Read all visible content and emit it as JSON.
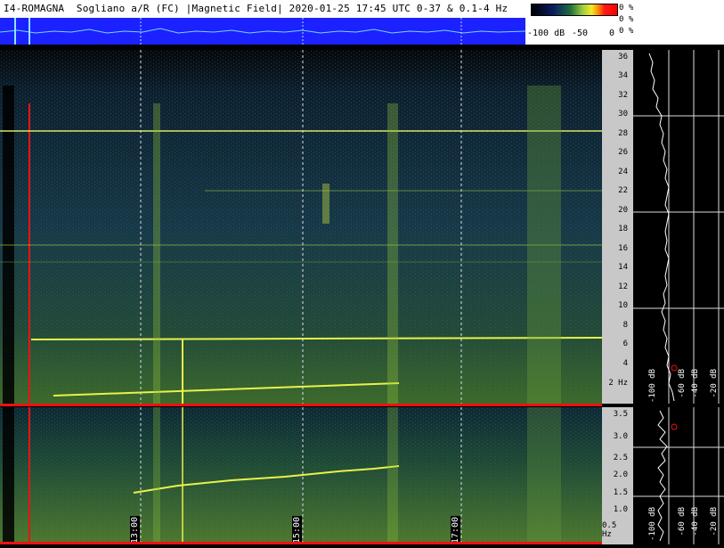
{
  "header": {
    "title": "I4-ROMAGNA  Sogliano a/R (FC) |Magnetic Field| 2020-01-25 17:45 UTC 0-37 & 0.1-4 Hz"
  },
  "legend": {
    "pct_top": "0 %",
    "pct_mid": "0 %",
    "pct_bot": "0 %",
    "scale_left": "-100 dB",
    "scale_mid": "-50",
    "scale_right": "0"
  },
  "upper_axis": {
    "ticks": [
      "36",
      "34",
      "32",
      "30",
      "28",
      "26",
      "24",
      "22",
      "20",
      "18",
      "16",
      "14",
      "12",
      "10",
      "8",
      "6",
      "4",
      "2 Hz"
    ]
  },
  "lower_axis": {
    "ticks": [
      "3.5",
      "3.0",
      "2.5",
      "2.0",
      "1.5",
      "1.0",
      "0.5 Hz"
    ]
  },
  "time_labels": [
    "13:00",
    "15:00",
    "17:00"
  ],
  "side_panel": {
    "db_labels": [
      "-100 dB",
      "-60 dB",
      "-40 dB",
      "-20 dB"
    ]
  },
  "colors": {
    "accent_blue": "#1b22ff",
    "red_marker": "#e11111",
    "line_yellow": "#e8f24a",
    "bg_dark": "#0f2535"
  }
}
